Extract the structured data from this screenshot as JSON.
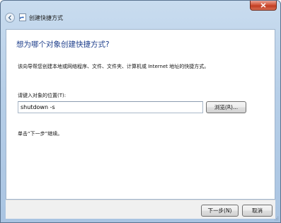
{
  "window": {
    "title": "创建快捷方式",
    "close_label": "关闭"
  },
  "wizard": {
    "heading": "想为哪个对象创建快捷方式?",
    "description": "该向导帮您创建本地或网络程序、文件、文件夹、计算机或 Internet 地址的快捷方式。",
    "location_label": "请键入对象的位置(T):",
    "location_value": "shutdown -s",
    "browse_label": "浏览(R)...",
    "next_hint": "单击“下一步”继续。"
  },
  "footer": {
    "next_label": "下一步(N)",
    "cancel_label": "取消"
  },
  "icons": {
    "back": "back-arrow-icon",
    "app": "shortcut-icon",
    "close": "close-icon"
  },
  "colors": {
    "heading": "#1e3f8c",
    "close_button": "#c8472b",
    "titlebar": "#b7cfe8"
  }
}
